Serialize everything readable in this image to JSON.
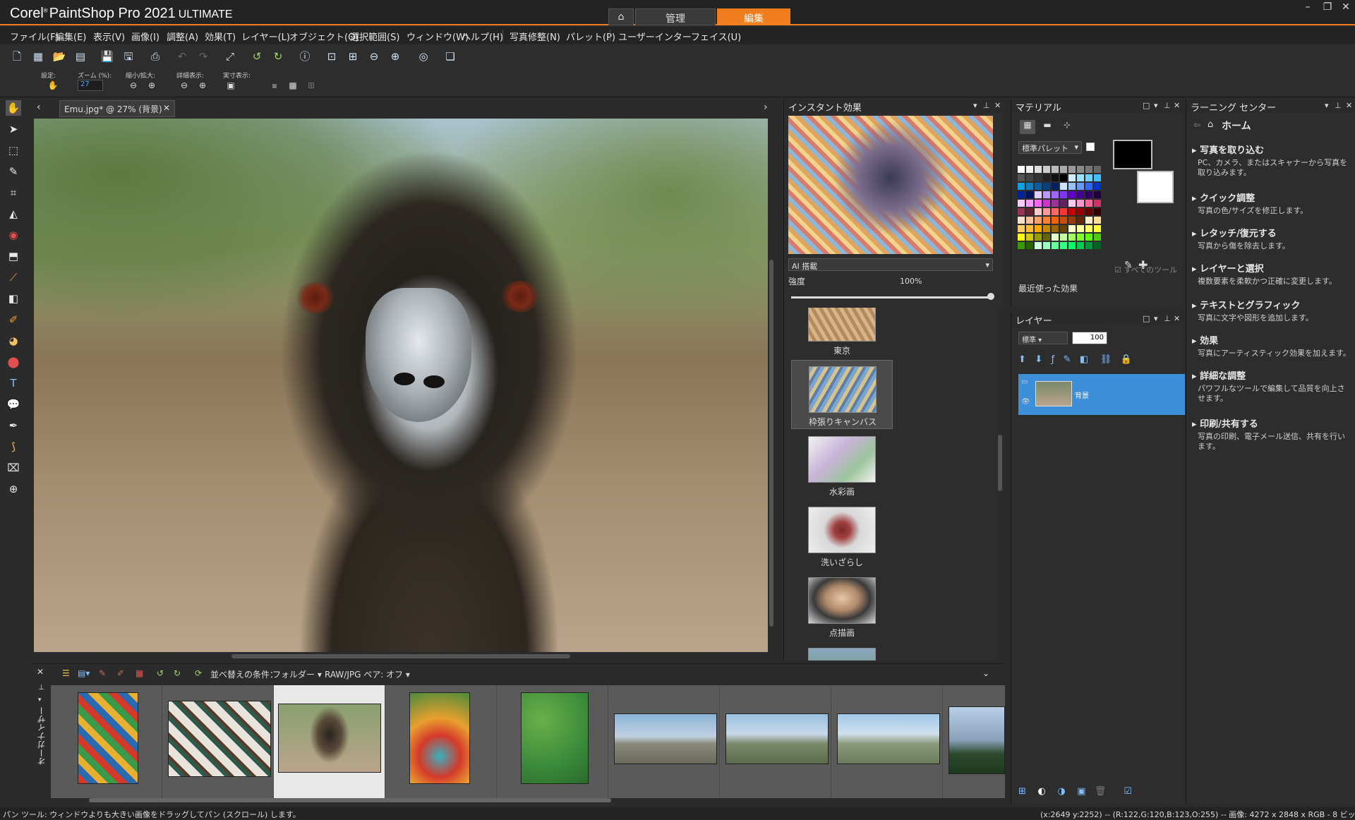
{
  "app": {
    "title": "PaintShop Pro 2021",
    "brand": "Corel",
    "edition": "ULTIMATE"
  },
  "modes": {
    "manage": "管理",
    "edit": "編集"
  },
  "menu": [
    "ファイル(F)",
    "編集(E)",
    "表示(V)",
    "画像(I)",
    "調整(A)",
    "効果(T)",
    "レイヤー(L)",
    "オブジェクト(O)",
    "選択範囲(S)",
    "ウィンドウ(W)",
    "ヘルプ(H)",
    "写真修整(N)",
    "パレット(P)",
    "ユーザーインターフェイス(U)"
  ],
  "options": {
    "preset_label": "設定:",
    "zoom_label": "ズーム (%):",
    "zoom_value": "27",
    "zoom_inout_label": "縮小/拡大:",
    "fit_label": "詳細表示:",
    "actual_label": "実寸表示:"
  },
  "document": {
    "tab_label": "Emu.jpg* @  27% (背景)"
  },
  "instant_effects": {
    "title": "インスタント効果",
    "category": "AI 搭載",
    "strength_label": "強度",
    "strength_value": "100%",
    "strength": 1.0,
    "items": [
      "東京",
      "枠張りキャンバス",
      "水彩画",
      "洗いざらし",
      "点描画"
    ]
  },
  "materials": {
    "title": "マテリアル",
    "palette": "標準パレット",
    "all_tools": "すべてのツール",
    "recent": "最近使った効果"
  },
  "layers": {
    "title": "レイヤー",
    "blend": "標準",
    "opacity": "100",
    "layer_name": "背景"
  },
  "learning": {
    "title": "ラーニング センター",
    "home": "ホーム",
    "items": [
      {
        "title": "写真を取り込む",
        "desc": "PC、カメラ、またはスキャナーから写真を取り込みます。"
      },
      {
        "title": "クイック調整",
        "desc": "写真の色/サイズを修正します。"
      },
      {
        "title": "レタッチ/復元する",
        "desc": "写真から傷を除去します。"
      },
      {
        "title": "レイヤーと選択",
        "desc": "複数要素を柔軟かつ正確に変更します。"
      },
      {
        "title": "テキストとグラフィック",
        "desc": "写真に文字や図形を追加します。"
      },
      {
        "title": "効果",
        "desc": "写真にアーティスティック効果を加えます。"
      },
      {
        "title": "詳細な調整",
        "desc": "パワフルなツールで編集して品質を向上させます。"
      },
      {
        "title": "印刷/共有する",
        "desc": "写真の印刷、電子メール送信、共有を行います。"
      }
    ]
  },
  "organizer": {
    "label": "オーガナイザー",
    "sort_label": "並べ替えの条件：",
    "sort_value": "フォルダー",
    "raw_pair": "RAW/JPG ペア: オフ"
  },
  "status": {
    "left": "パン ツール: ウィンドウよりも大きい画像をドラッグしてパン (スクロール) します。",
    "right": "(x:2649 y:2252) -- (R:122,G:120,B:123,O:255) -- 画像:  4272 x 2848 x RGB - 8 ビット/チャネル"
  },
  "colors": {
    "accent": "#f07d1e",
    "selection": "#3d8fd8",
    "panel": "#2d2d2d"
  }
}
